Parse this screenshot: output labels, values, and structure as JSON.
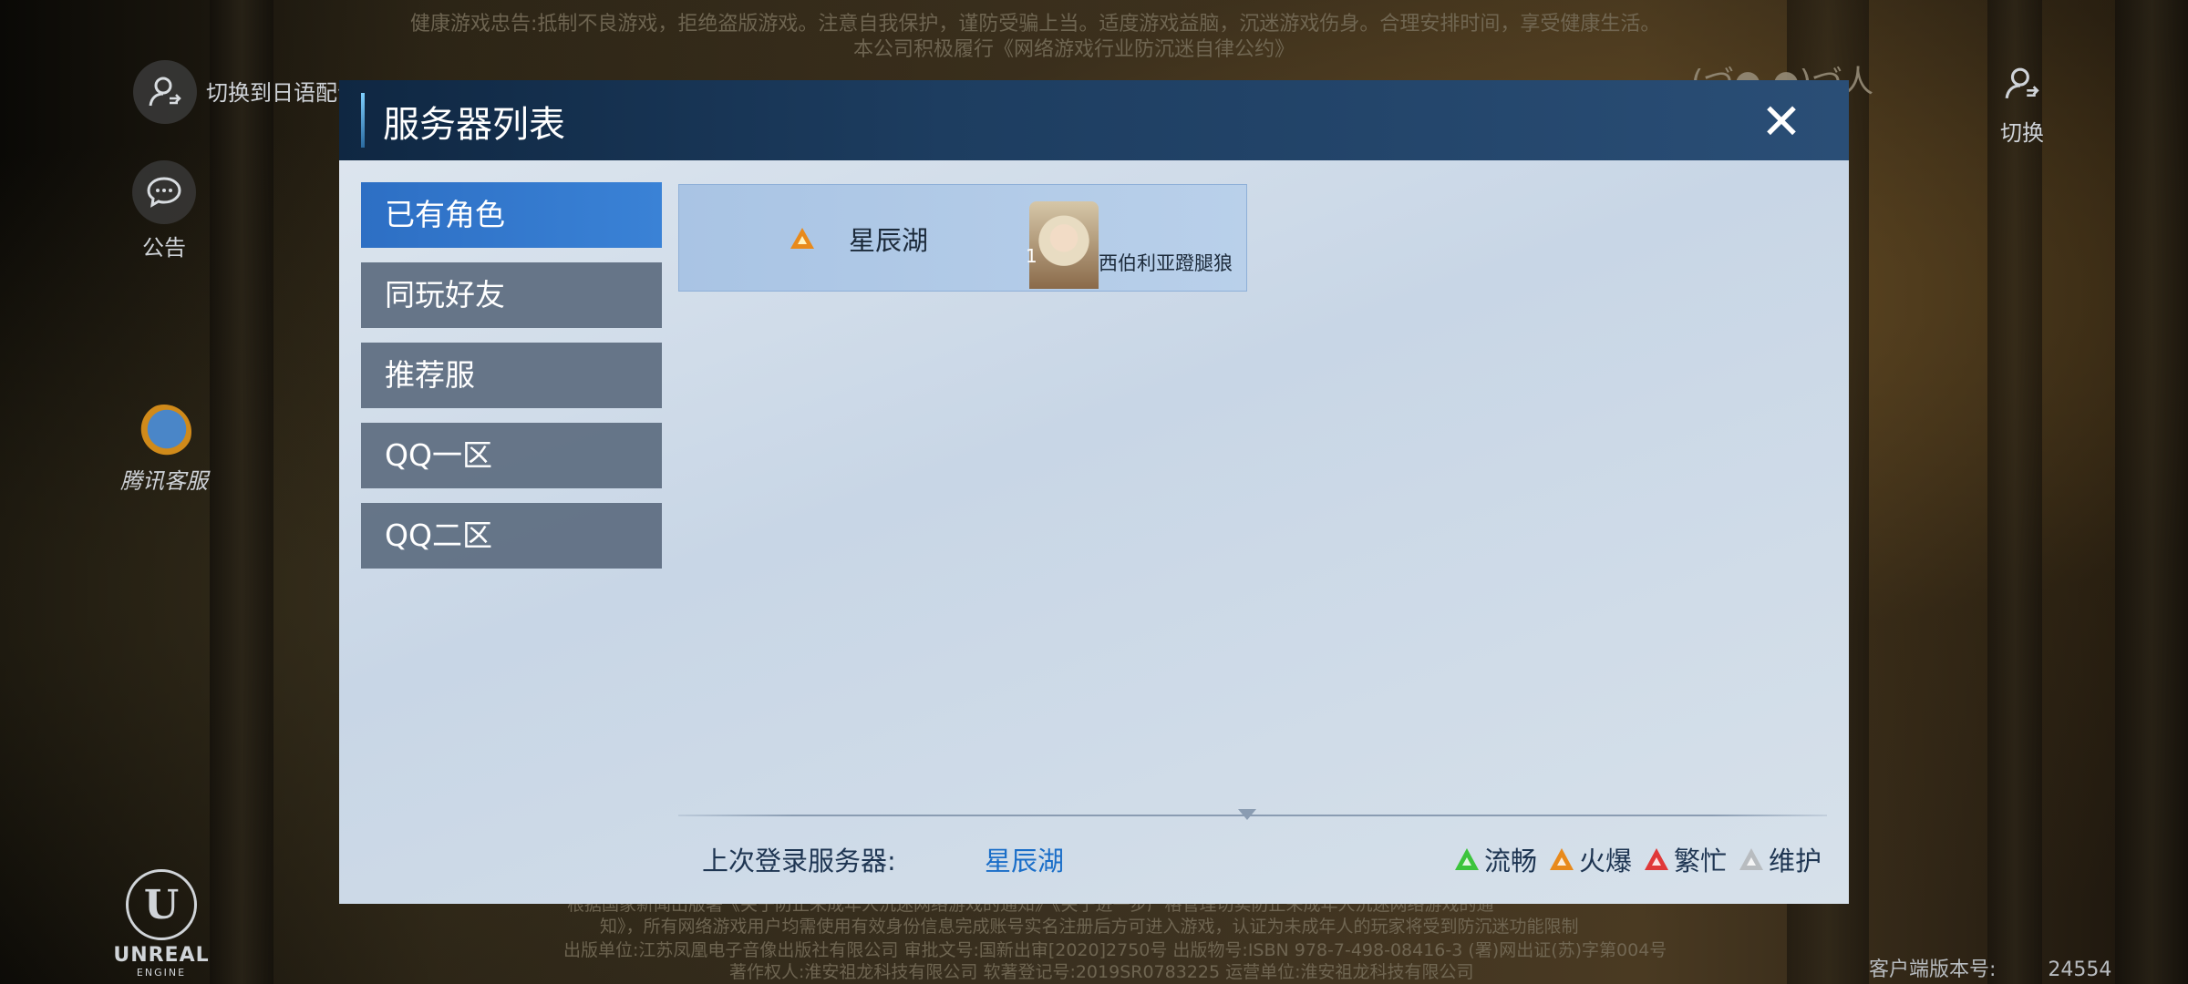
{
  "background": {
    "health_notice_line1": "健康游戏忠告:抵制不良游戏，拒绝盗版游戏。注意自我保护，谨防受骗上当。适度游戏益脑，沉迷游戏伤身。合理安排时间，享受健康生活。",
    "health_notice_line2": "本公司积极履行《网络游戏行业防沉迷自律公约》",
    "emoticon": "(づ●-●)づ人",
    "legal_line1": "根据国家新闻出版署《关于防止未成年人沉迷网络游戏的通知》《关于进一步严格管理切实防止未成年人沉迷网络游戏的通",
    "legal_line2": "知》，所有网络游戏用户均需使用有效身份信息完成账号实名注册后方可进入游戏，认证为未成年人的玩家将受到防沉迷功能限制",
    "legal_line3": "出版单位:江苏凤凰电子音像出版社有限公司 审批文号:国新出审[2020]2750号 出版物号:ISBN 978-7-498-08416-3 (署)网出证(苏)字第004号",
    "legal_line4": "著作权人:淮安祖龙科技有限公司 软著登记号:2019SR0783225 运营单位:淮安祖龙科技有限公司",
    "client_version_label": "客户端版本号:",
    "client_version_value": "24554"
  },
  "side": {
    "switch_language_label": "切换到日语配音",
    "notice_label": "公告",
    "tencent_service_label": "腾讯客服",
    "switch_account_label": "切换",
    "engine_logo_text": "UNREAL",
    "engine_logo_subtext": "ENGINE"
  },
  "modal": {
    "title": "服务器列表",
    "close_symbol": "✕",
    "tabs": [
      {
        "label": "已有角色",
        "active": true
      },
      {
        "label": "同玩好友",
        "active": false
      },
      {
        "label": "推荐服",
        "active": false
      },
      {
        "label": "QQ一区",
        "active": false
      },
      {
        "label": "QQ二区",
        "active": false
      }
    ],
    "server_card": {
      "server_name": "星辰湖",
      "status_color": "#e88a1c",
      "character_level": "1",
      "character_name": "西伯利亚蹬腿狼"
    },
    "footer": {
      "last_login_label": "上次登录服务器:",
      "last_login_value": "星辰湖"
    },
    "legend": [
      {
        "label": "流畅",
        "color": "#3cc43c"
      },
      {
        "label": "火爆",
        "color": "#e88a1c"
      },
      {
        "label": "繁忙",
        "color": "#e03838"
      },
      {
        "label": "维护",
        "color": "#b8bcc0"
      }
    ]
  }
}
